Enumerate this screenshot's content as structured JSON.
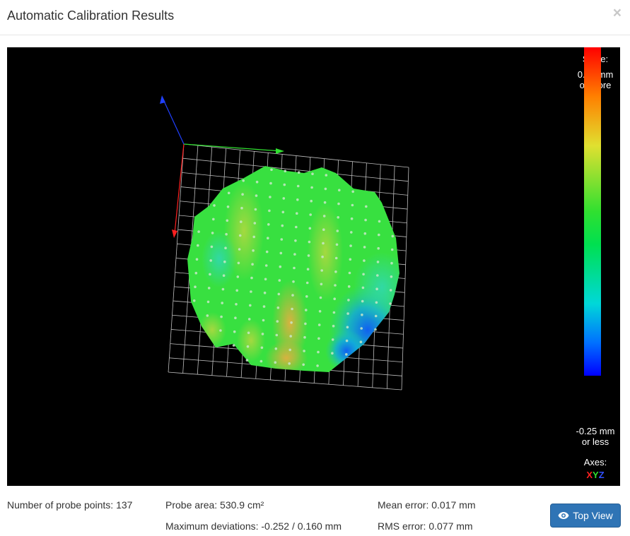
{
  "modal": {
    "title": "Automatic Calibration Results",
    "close_symbol": "×"
  },
  "scale": {
    "title": "Scale:",
    "top_line1": "0.25 mm",
    "top_line2": "or more",
    "bottom_line1": "-0.25 mm",
    "bottom_line2": "or less",
    "axes_title": "Axes:",
    "axis_x": "X",
    "axis_y": "Y",
    "axis_z": "Z",
    "colors": {
      "high": "#ff0000",
      "mid": "#30e030",
      "low": "#0000ff",
      "axis_x": "#ff2020",
      "axis_y": "#30e030",
      "axis_z": "#3050ff"
    }
  },
  "stats": {
    "probe_points": "Number of probe points: 137",
    "probe_area": "Probe area: 530.9 cm²",
    "max_deviations": "Maximum deviations: -0.252 / 0.160 mm",
    "mean_error": "Mean error: 0.017 mm",
    "rms_error": "RMS error: 0.077 mm"
  },
  "buttons": {
    "top_view": "Top View",
    "top_view_icon": "eye-icon"
  }
}
